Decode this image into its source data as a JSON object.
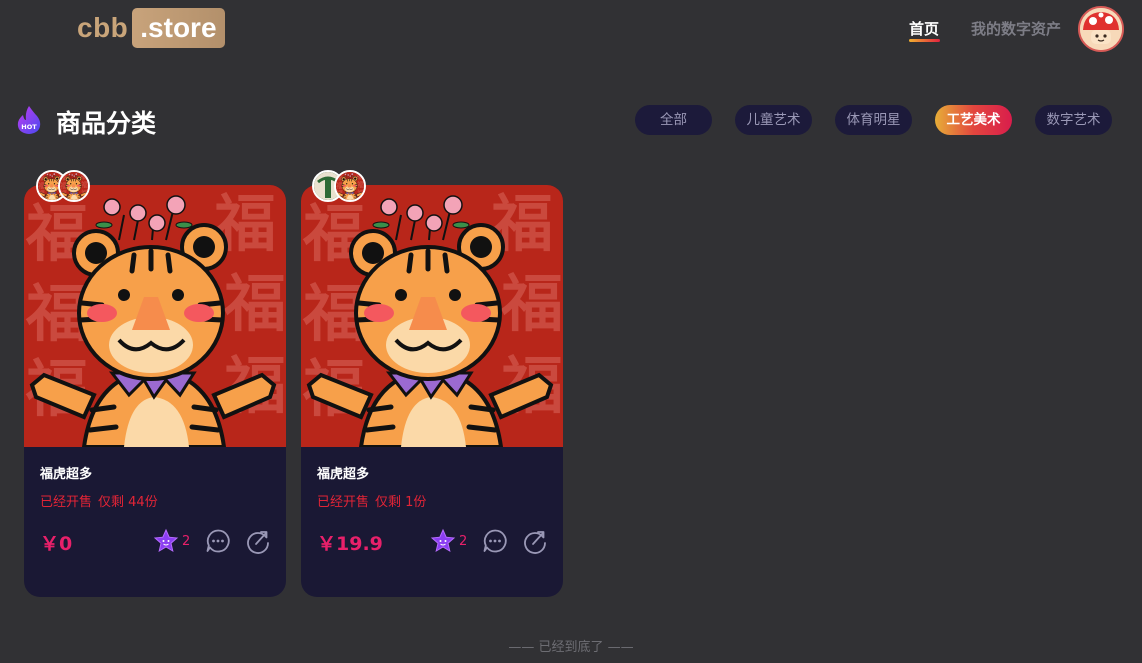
{
  "header": {
    "logo_main": "cbb",
    "logo_badge": ".store",
    "nav": [
      {
        "label": "首页",
        "active": true
      },
      {
        "label": "我的数字资产",
        "active": false
      }
    ],
    "avatar_icon": "mushroom-avatar-icon"
  },
  "categories": {
    "title": "商品分类",
    "title_icon": "hot-flame-icon",
    "chips": [
      "全部",
      "儿童艺术",
      "体育明星",
      "工艺美术",
      "数字艺术"
    ],
    "active_chip": "工艺美术"
  },
  "products": [
    {
      "name": "福虎超多",
      "status": "已经开售",
      "remaining": "仅剩 44份",
      "price": "￥0",
      "likes": "2"
    },
    {
      "name": "福虎超多",
      "status": "已经开售",
      "remaining": "仅剩 1份",
      "price": "￥19.9",
      "likes": "2"
    }
  ],
  "footer": {
    "end_note": "—— 已经到底了 ——"
  },
  "colors": {
    "background": "#313134",
    "card": "#1a1834",
    "accent_pink": "#e8206a",
    "status_red": "#e22436",
    "logo_gold": "#c9a57a"
  }
}
